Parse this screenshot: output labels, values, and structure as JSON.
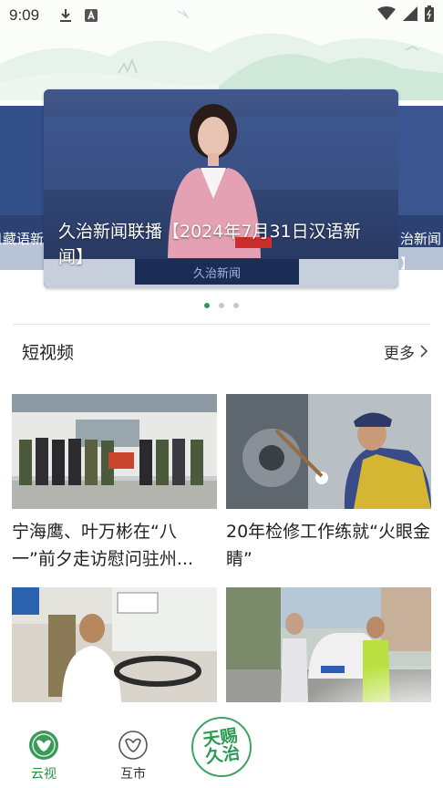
{
  "status": {
    "time": "9:09",
    "icons": [
      "download-icon",
      "a-badge-icon",
      "wifi-icon",
      "signal-icon",
      "battery-icon"
    ]
  },
  "carousel": {
    "left_partial_text": "日藏语新",
    "main_title": "久治新闻联播【2024年7月31日汉语新闻】",
    "right_partial_text_line1": "治新闻",
    "right_partial_text_line2": "】",
    "dots": 3,
    "active_dot": 0
  },
  "section": {
    "title": "短视频",
    "more_label": "更多"
  },
  "videos": [
    {
      "title": "宁海鹰、叶万彬在“八一”前夕走访慰问驻州..."
    },
    {
      "title": "20年检修工作练就“火眼金睛”"
    },
    {
      "title": ""
    },
    {
      "title": ""
    }
  ],
  "nav": {
    "items": [
      {
        "label": "云视",
        "icon": "yunshi-icon"
      },
      {
        "label": "互市",
        "icon": "hushi-icon"
      }
    ],
    "logo_text": "天赐久治"
  },
  "colors": {
    "accent": "#2f9a54",
    "nav_active": "#2f8a4b"
  }
}
